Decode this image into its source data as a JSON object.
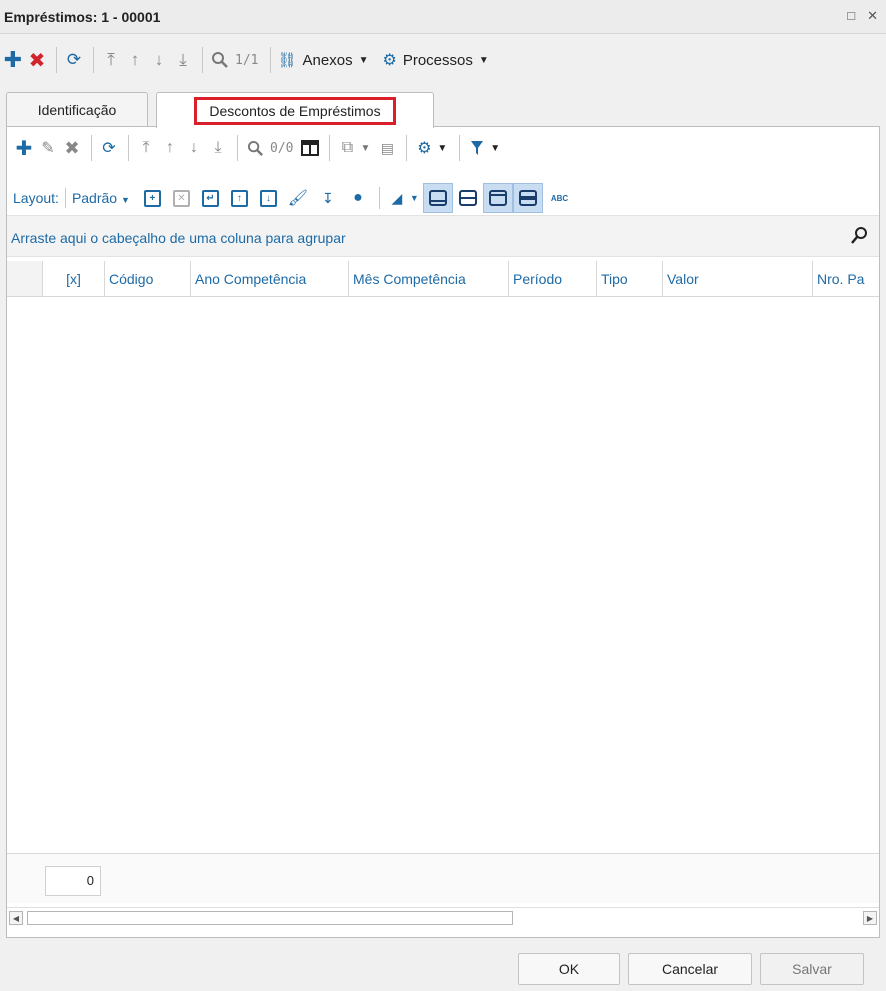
{
  "window": {
    "title": "Empréstimos: 1 - 00001",
    "minimize": "□",
    "close": "✕"
  },
  "main_toolbar": {
    "record_counter": "1/1",
    "attachments_label": "Anexos",
    "processes_label": "Processos"
  },
  "tabs": [
    {
      "label": "Identificação",
      "active": false
    },
    {
      "label": "Descontos de Empréstimos",
      "active": true
    }
  ],
  "grid_toolbar": {
    "record_counter": "0/0"
  },
  "layout_bar": {
    "label": "Layout:",
    "selected_layout": "Padrão",
    "abc": "ABC"
  },
  "group_bar": {
    "text": "Arraste aqui o cabeçalho de uma coluna para agrupar"
  },
  "grid": {
    "columns": [
      "[x]",
      "Código",
      "Ano Competência",
      "Mês Competência",
      "Período",
      "Tipo",
      "Valor",
      "Nro. Pa"
    ],
    "rows": [],
    "total_count": "0"
  },
  "buttons": {
    "ok": "OK",
    "cancel": "Cancelar",
    "save": "Salvar"
  },
  "colors": {
    "accent": "#1d6aa5",
    "highlight_border": "#d9202a"
  }
}
